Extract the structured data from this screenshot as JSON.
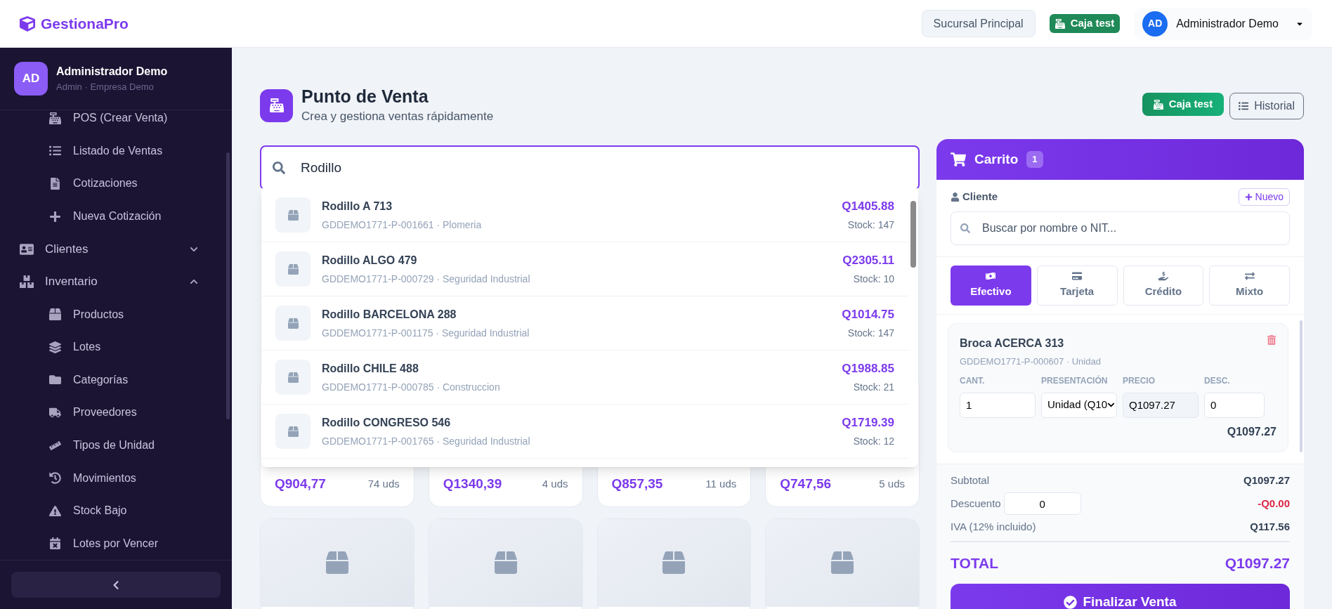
{
  "header": {
    "brand": "GestionaPro",
    "branch": "Sucursal Principal",
    "register": "Caja test",
    "user": {
      "initials": "AD",
      "name": "Administrador Demo"
    }
  },
  "sidebar": {
    "user": {
      "initials": "AD",
      "name": "Administrador Demo",
      "role": "Admin · Empresa Demo"
    },
    "nav": [
      {
        "children": [
          {
            "label": "POS (Crear Venta)"
          },
          {
            "label": "Listado de Ventas"
          },
          {
            "label": "Cotizaciones"
          },
          {
            "label": "Nueva Cotización"
          }
        ]
      },
      {
        "label": "Clientes",
        "expanded": false
      },
      {
        "label": "Inventario",
        "expanded": true,
        "children": [
          {
            "label": "Productos"
          },
          {
            "label": "Lotes"
          },
          {
            "label": "Categorías"
          },
          {
            "label": "Proveedores"
          },
          {
            "label": "Tipos de Unidad"
          },
          {
            "label": "Movimientos"
          },
          {
            "label": "Stock Bajo"
          },
          {
            "label": "Lotes por Vencer"
          }
        ]
      }
    ]
  },
  "page": {
    "title": "Punto de Venta",
    "subtitle": "Crea y gestiona ventas rápidamente",
    "register_button": "Caja test",
    "history_button": "Historial"
  },
  "search": {
    "value": "Rodillo"
  },
  "results": [
    {
      "name": "Rodillo A 713",
      "code": "GDDEMO1771-P-001661 · Plomeria",
      "price": "Q1405.88",
      "stock": "Stock: 147"
    },
    {
      "name": "Rodillo ALGO 479",
      "code": "GDDEMO1771-P-000729 · Seguridad Industrial",
      "price": "Q2305.11",
      "stock": "Stock: 10"
    },
    {
      "name": "Rodillo BARCELONA 288",
      "code": "GDDEMO1771-P-001175 · Seguridad Industrial",
      "price": "Q1014.75",
      "stock": "Stock: 147"
    },
    {
      "name": "Rodillo CHILE 488",
      "code": "GDDEMO1771-P-000785 · Construccion",
      "price": "Q1988.85",
      "stock": "Stock: 21"
    },
    {
      "name": "Rodillo CONGRESO 546",
      "code": "GDDEMO1771-P-001765 · Seguridad Industrial",
      "price": "Q1719.39",
      "stock": "Stock: 12"
    }
  ],
  "products": [
    {
      "kind": "priced",
      "price": "Q904,77",
      "units": "74 uds"
    },
    {
      "kind": "priced",
      "price": "Q1340,39",
      "units": "4 uds"
    },
    {
      "kind": "priced",
      "price": "Q857,35",
      "units": "11 uds"
    },
    {
      "kind": "priced",
      "price": "Q747,56",
      "units": "5 uds"
    },
    {
      "kind": "image_only"
    },
    {
      "kind": "image_only"
    },
    {
      "kind": "image_only"
    },
    {
      "kind": "image_only"
    }
  ],
  "cart": {
    "title": "Carrito",
    "count": "1",
    "client_label": "Cliente",
    "new_button": "Nuevo",
    "client_search": {
      "placeholder": "Buscar por nombre o NIT..."
    },
    "payment_methods": [
      {
        "label": "Efectivo",
        "selected": true
      },
      {
        "label": "Tarjeta",
        "selected": false
      },
      {
        "label": "Crédito",
        "selected": false
      },
      {
        "label": "Mixto",
        "selected": false
      }
    ],
    "items": [
      {
        "name": "Broca ACERCA 313",
        "code": "GDDEMO1771-P-000607 · Unidad",
        "qty_label": "CANT.",
        "qty": "1",
        "presentation_label": "PRESENTACIÓN",
        "presentation": "Unidad (Q10",
        "price_label": "PRECIO",
        "price": "Q1097.27",
        "discount_label": "DESC.",
        "discount": "0",
        "line_total": "Q1097.27"
      }
    ],
    "subtotal_label": "Subtotal",
    "subtotal": "Q1097.27",
    "discount_label": "Descuento",
    "discount_input": "0",
    "discount": "-Q0.00",
    "tax_label": "IVA (12% incluido)",
    "tax": "Q117.56",
    "total_label": "TOTAL",
    "total": "Q1097.27",
    "finish_button": "Finalizar Venta"
  }
}
